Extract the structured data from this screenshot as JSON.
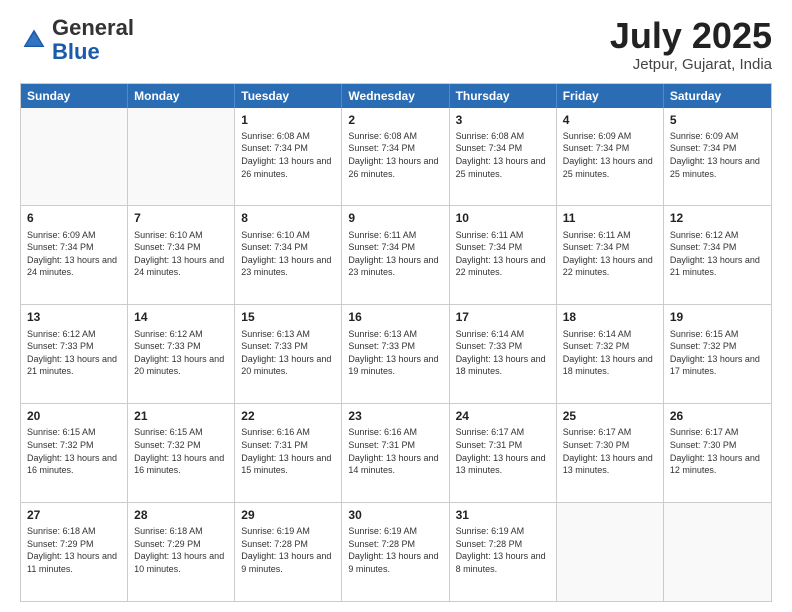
{
  "header": {
    "logo_general": "General",
    "logo_blue": "Blue",
    "month_title": "July 2025",
    "location": "Jetpur, Gujarat, India"
  },
  "weekdays": [
    "Sunday",
    "Monday",
    "Tuesday",
    "Wednesday",
    "Thursday",
    "Friday",
    "Saturday"
  ],
  "rows": [
    [
      {
        "day": "",
        "sunrise": "",
        "sunset": "",
        "daylight": ""
      },
      {
        "day": "",
        "sunrise": "",
        "sunset": "",
        "daylight": ""
      },
      {
        "day": "1",
        "sunrise": "Sunrise: 6:08 AM",
        "sunset": "Sunset: 7:34 PM",
        "daylight": "Daylight: 13 hours and 26 minutes."
      },
      {
        "day": "2",
        "sunrise": "Sunrise: 6:08 AM",
        "sunset": "Sunset: 7:34 PM",
        "daylight": "Daylight: 13 hours and 26 minutes."
      },
      {
        "day": "3",
        "sunrise": "Sunrise: 6:08 AM",
        "sunset": "Sunset: 7:34 PM",
        "daylight": "Daylight: 13 hours and 25 minutes."
      },
      {
        "day": "4",
        "sunrise": "Sunrise: 6:09 AM",
        "sunset": "Sunset: 7:34 PM",
        "daylight": "Daylight: 13 hours and 25 minutes."
      },
      {
        "day": "5",
        "sunrise": "Sunrise: 6:09 AM",
        "sunset": "Sunset: 7:34 PM",
        "daylight": "Daylight: 13 hours and 25 minutes."
      }
    ],
    [
      {
        "day": "6",
        "sunrise": "Sunrise: 6:09 AM",
        "sunset": "Sunset: 7:34 PM",
        "daylight": "Daylight: 13 hours and 24 minutes."
      },
      {
        "day": "7",
        "sunrise": "Sunrise: 6:10 AM",
        "sunset": "Sunset: 7:34 PM",
        "daylight": "Daylight: 13 hours and 24 minutes."
      },
      {
        "day": "8",
        "sunrise": "Sunrise: 6:10 AM",
        "sunset": "Sunset: 7:34 PM",
        "daylight": "Daylight: 13 hours and 23 minutes."
      },
      {
        "day": "9",
        "sunrise": "Sunrise: 6:11 AM",
        "sunset": "Sunset: 7:34 PM",
        "daylight": "Daylight: 13 hours and 23 minutes."
      },
      {
        "day": "10",
        "sunrise": "Sunrise: 6:11 AM",
        "sunset": "Sunset: 7:34 PM",
        "daylight": "Daylight: 13 hours and 22 minutes."
      },
      {
        "day": "11",
        "sunrise": "Sunrise: 6:11 AM",
        "sunset": "Sunset: 7:34 PM",
        "daylight": "Daylight: 13 hours and 22 minutes."
      },
      {
        "day": "12",
        "sunrise": "Sunrise: 6:12 AM",
        "sunset": "Sunset: 7:34 PM",
        "daylight": "Daylight: 13 hours and 21 minutes."
      }
    ],
    [
      {
        "day": "13",
        "sunrise": "Sunrise: 6:12 AM",
        "sunset": "Sunset: 7:33 PM",
        "daylight": "Daylight: 13 hours and 21 minutes."
      },
      {
        "day": "14",
        "sunrise": "Sunrise: 6:12 AM",
        "sunset": "Sunset: 7:33 PM",
        "daylight": "Daylight: 13 hours and 20 minutes."
      },
      {
        "day": "15",
        "sunrise": "Sunrise: 6:13 AM",
        "sunset": "Sunset: 7:33 PM",
        "daylight": "Daylight: 13 hours and 20 minutes."
      },
      {
        "day": "16",
        "sunrise": "Sunrise: 6:13 AM",
        "sunset": "Sunset: 7:33 PM",
        "daylight": "Daylight: 13 hours and 19 minutes."
      },
      {
        "day": "17",
        "sunrise": "Sunrise: 6:14 AM",
        "sunset": "Sunset: 7:33 PM",
        "daylight": "Daylight: 13 hours and 18 minutes."
      },
      {
        "day": "18",
        "sunrise": "Sunrise: 6:14 AM",
        "sunset": "Sunset: 7:32 PM",
        "daylight": "Daylight: 13 hours and 18 minutes."
      },
      {
        "day": "19",
        "sunrise": "Sunrise: 6:15 AM",
        "sunset": "Sunset: 7:32 PM",
        "daylight": "Daylight: 13 hours and 17 minutes."
      }
    ],
    [
      {
        "day": "20",
        "sunrise": "Sunrise: 6:15 AM",
        "sunset": "Sunset: 7:32 PM",
        "daylight": "Daylight: 13 hours and 16 minutes."
      },
      {
        "day": "21",
        "sunrise": "Sunrise: 6:15 AM",
        "sunset": "Sunset: 7:32 PM",
        "daylight": "Daylight: 13 hours and 16 minutes."
      },
      {
        "day": "22",
        "sunrise": "Sunrise: 6:16 AM",
        "sunset": "Sunset: 7:31 PM",
        "daylight": "Daylight: 13 hours and 15 minutes."
      },
      {
        "day": "23",
        "sunrise": "Sunrise: 6:16 AM",
        "sunset": "Sunset: 7:31 PM",
        "daylight": "Daylight: 13 hours and 14 minutes."
      },
      {
        "day": "24",
        "sunrise": "Sunrise: 6:17 AM",
        "sunset": "Sunset: 7:31 PM",
        "daylight": "Daylight: 13 hours and 13 minutes."
      },
      {
        "day": "25",
        "sunrise": "Sunrise: 6:17 AM",
        "sunset": "Sunset: 7:30 PM",
        "daylight": "Daylight: 13 hours and 13 minutes."
      },
      {
        "day": "26",
        "sunrise": "Sunrise: 6:17 AM",
        "sunset": "Sunset: 7:30 PM",
        "daylight": "Daylight: 13 hours and 12 minutes."
      }
    ],
    [
      {
        "day": "27",
        "sunrise": "Sunrise: 6:18 AM",
        "sunset": "Sunset: 7:29 PM",
        "daylight": "Daylight: 13 hours and 11 minutes."
      },
      {
        "day": "28",
        "sunrise": "Sunrise: 6:18 AM",
        "sunset": "Sunset: 7:29 PM",
        "daylight": "Daylight: 13 hours and 10 minutes."
      },
      {
        "day": "29",
        "sunrise": "Sunrise: 6:19 AM",
        "sunset": "Sunset: 7:28 PM",
        "daylight": "Daylight: 13 hours and 9 minutes."
      },
      {
        "day": "30",
        "sunrise": "Sunrise: 6:19 AM",
        "sunset": "Sunset: 7:28 PM",
        "daylight": "Daylight: 13 hours and 9 minutes."
      },
      {
        "day": "31",
        "sunrise": "Sunrise: 6:19 AM",
        "sunset": "Sunset: 7:28 PM",
        "daylight": "Daylight: 13 hours and 8 minutes."
      },
      {
        "day": "",
        "sunrise": "",
        "sunset": "",
        "daylight": ""
      },
      {
        "day": "",
        "sunrise": "",
        "sunset": "",
        "daylight": ""
      }
    ]
  ]
}
